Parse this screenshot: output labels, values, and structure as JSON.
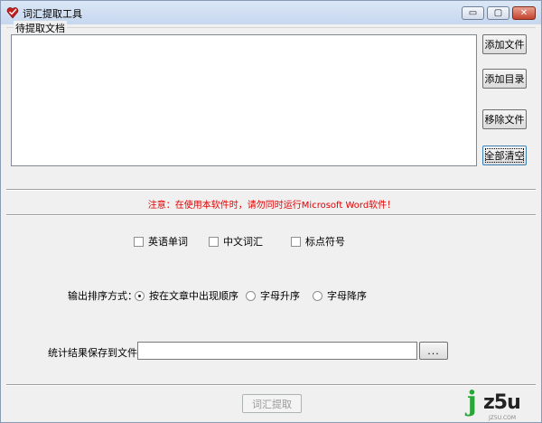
{
  "window": {
    "title": "词汇提取工具",
    "controls": {
      "minimize": "▭",
      "maximize": "▢",
      "close": "✕"
    }
  },
  "source_group": {
    "title": "待提取文档",
    "buttons": {
      "add_file": "添加文件",
      "add_dir": "添加目录",
      "remove_file": "移除文件",
      "clear_all": "全部清空"
    }
  },
  "warning": "注意：在使用本软件时，请勿同时运行Microsoft Word软件！",
  "options": {
    "english_words": "英语单词",
    "chinese_words": "中文词汇",
    "punctuation": "标点符号"
  },
  "sort": {
    "label": "输出排序方式：",
    "by_order": "按在文章中出现顺序",
    "ascending": "字母升序",
    "descending": "字母降序",
    "selected": "by_order"
  },
  "save": {
    "label": "统计结果保存到文件：",
    "value": "",
    "browse": "..."
  },
  "extract_button": "词汇提取",
  "watermark": {
    "j": "j",
    "rest": "z5u",
    "sub": "JZ5U.COM"
  },
  "colors": {
    "warning": "#e00000",
    "logo_green": "#2aa538"
  }
}
